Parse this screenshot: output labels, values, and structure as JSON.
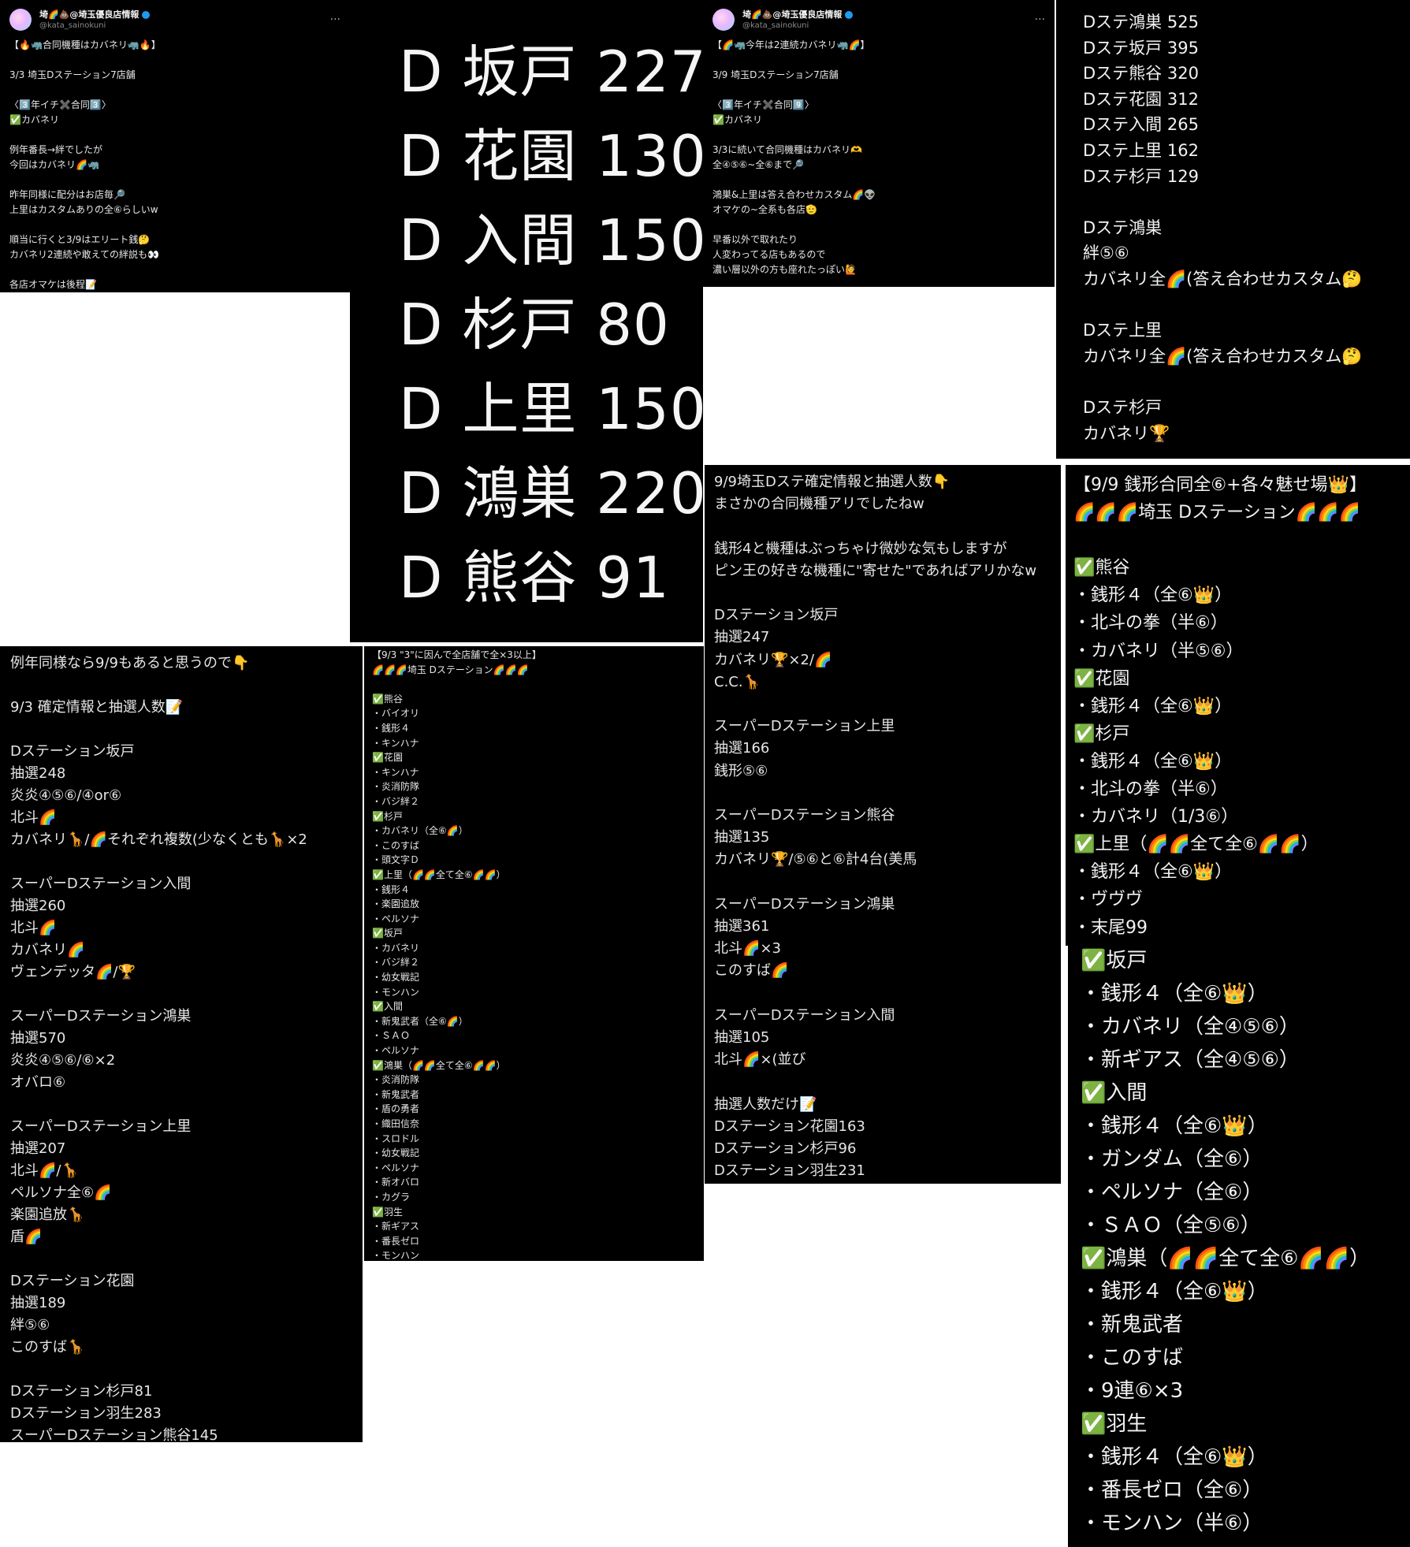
{
  "tweet_a": {
    "display_name": "埼🌈💩@埼玉優良店情報",
    "handle": "@kata_sainokuni",
    "more": "···",
    "lines": [
      "【🔥🦏合同機種はカバネリ🦏🔥】",
      "",
      "3/3 埼玉Dステーション7店舗",
      "",
      "〈3️⃣年イチ✖️合同3️⃣〉",
      "✅カバネリ",
      "",
      "例年番長→絆でしたが",
      "今回はカバネリ🌈🦏",
      "",
      "昨年同様に配分はお店毎🔎",
      "上里はカスタムありの全⑥らしいw",
      "",
      "順当に行くと3/9はエリート銭🤔",
      "カバネリ2連続や敢えての絆説も👀",
      "",
      "各店オマケは後程📝"
    ]
  },
  "big_counts": {
    "lines": [
      "D 坂戸 227",
      "D 花園 130",
      "D 入間 150",
      "D 杉戸 80",
      "D 上里 150",
      "D 鴻巣 220",
      "D 熊谷 91"
    ]
  },
  "tweet_b": {
    "display_name": "埼🌈💩@埼玉優良店情報",
    "handle": "@kata_sainokuni",
    "more": "···",
    "lines": [
      "【🌈🦏今年は2連続カバネリ🦏🌈】",
      "",
      "3/9 埼玉Dステーション7店舗",
      "",
      "〈3️⃣年イチ✖️合同9️⃣〉",
      "✅カバネリ",
      "",
      "3/3に続いて合同機種はカバネリ🫶",
      "全④⑤⑥~全⑥まで🔎",
      "",
      "鴻巣&上里は答え合わせカスタム🌈👽",
      "オマケの~全系も各店🫡",
      "",
      "早番以外で取れたり",
      "人変わってる店もあるので",
      "濃い層以外の方も座れたっぽい🙋"
    ]
  },
  "dste_counts": {
    "lines": [
      "Dステ鴻巣 525",
      "Dステ坂戸 395",
      "Dステ熊谷 320",
      "Dステ花園 312",
      "Dステ入間 265",
      "Dステ上里 162",
      "Dステ杉戸 129",
      "",
      "Dステ鴻巣",
      "絆⑤⑥",
      "カバネリ全🌈(答え合わせカスタム🤔",
      "",
      "Dステ上里",
      "カバネリ全🌈(答え合わせカスタム🤔",
      "",
      "Dステ杉戸",
      "カバネリ🏆"
    ]
  },
  "info_99": {
    "lines": [
      "9/9埼玉Dステ確定情報と抽選人数👇",
      "まさかの合同機種アリでしたねw",
      "",
      "銭形4と機種はぶっちゃけ微妙な気もしますが",
      "ピン王の好きな機種に\"寄せた\"であればアリかなw",
      "",
      "Dステーション坂戸",
      "抽選247",
      "カバネリ🏆×2/🌈",
      "C.C.🦒",
      "",
      "スーパーDステーション上里",
      "抽選166",
      "銭形⑤⑥",
      "",
      "スーパーDステーション熊谷",
      "抽選135",
      "カバネリ🏆/⑤⑥と⑥計4台(美馬",
      "",
      "スーパーDステーション鴻巣",
      "抽選361",
      "北斗🌈×3",
      "このすば🌈",
      "",
      "スーパーDステーション入間",
      "抽選105",
      "北斗🌈×(並び",
      "",
      "抽選人数だけ📝",
      "Dステーション花園163",
      "Dステーション杉戸96",
      "Dステーション羽生231"
    ]
  },
  "zenigata_top": {
    "lines": [
      "【9/9 銭形合同全⑥+各々魅せ場👑】",
      "🌈🌈🌈埼玉 Dステーション🌈🌈🌈",
      "",
      "✅熊谷",
      "・銭形４（全⑥👑）",
      "・北斗の拳（半⑥）",
      "・カバネリ（半⑤⑥）",
      "✅花園",
      "・銭形４（全⑥👑）",
      "✅杉戸",
      "・銭形４（全⑥👑）",
      "・北斗の拳（半⑥）",
      "・カバネリ（1/3⑥）",
      "✅上里（🌈🌈全て全⑥🌈🌈）",
      "・銭形４（全⑥👑）",
      "・ヴヴヴ",
      "・末尾99"
    ]
  },
  "zenigata_bottom": {
    "lines": [
      "✅坂戸",
      "・銭形４（全⑥👑）",
      "・カバネリ（全④⑤⑥）",
      "・新ギアス（全④⑤⑥）",
      "✅入間",
      "・銭形４（全⑥👑）",
      "・ガンダム（全⑥）",
      "・ペルソナ（全⑥）",
      "・ＳＡＯ（全⑤⑥）",
      "✅鴻巣（🌈🌈全て全⑥🌈🌈）",
      "・銭形４（全⑥👑）",
      "・新鬼武者",
      "・このすば",
      "・9連⑥×3",
      "✅羽生",
      "・銭形４（全⑥👑）",
      "・番長ゼロ（全⑥）",
      "・モンハン（半⑥）"
    ]
  },
  "info_93": {
    "lines": [
      "例年同様なら9/9もあると思うので👇",
      "",
      "9/3 確定情報と抽選人数📝",
      "",
      "Dステーション坂戸",
      "抽選248",
      "炎炎④⑤⑥/④or⑥",
      "北斗🌈",
      "カバネリ🦒/🌈それぞれ複数(少なくとも🦒×2",
      "",
      "スーパーDステーション入間",
      "抽選260",
      "北斗🌈",
      "カバネリ🌈",
      "ヴェンデッタ🌈/🏆",
      "",
      "スーパーDステーション鴻巣",
      "抽選570",
      "炎炎④⑤⑥/⑥×2",
      "オバロ⑥",
      "",
      "スーパーDステーション上里",
      "抽選207",
      "北斗🌈/🦒",
      "ペルソナ全⑥🌈",
      "楽園追放🦒",
      "盾🌈",
      "",
      "Dステーション花園",
      "抽選189",
      "絆⑤⑥",
      "このすば🦒",
      "",
      "Dステーション杉戸81",
      "Dステーション羽生283",
      "スーパーDステーション熊谷145"
    ]
  },
  "list_93": {
    "lines": [
      "【9/3 \"3\"に因んで全店舗で全×3以上】",
      "🌈🌈🌈埼玉 Dステーション🌈🌈🌈",
      "",
      "✅熊谷",
      "・バイオリ",
      "・銭形４",
      "・キンハナ",
      "✅花園",
      "・キンハナ",
      "・炎消防隊",
      "・バジ絆２",
      "✅杉戸",
      "・カバネリ（全⑥🌈）",
      "・このすば",
      "・頭文字Ｄ",
      "✅上里（🌈🌈全て全⑥🌈🌈）",
      "・銭形４",
      "・楽園追放",
      "・ペルソナ",
      "✅坂戸",
      "・カバネリ",
      "・バジ絆２",
      "・幼女戦記",
      "・モンハン",
      "✅入間",
      "・新鬼武者（全⑥🌈）",
      "・ＳＡＯ",
      "・ペルソナ",
      "✅鴻巣（🌈🌈全て全⑥🌈🌈）",
      "・炎消防隊",
      "・新鬼武者",
      "・盾の勇者",
      "・織田信奈",
      "・スロドル",
      "・幼女戦記",
      "・ペルソナ",
      "・新オバロ",
      "・カグラ",
      "✅羽生",
      "・新ギアス",
      "・番長ゼロ",
      "・モンハン"
    ]
  }
}
